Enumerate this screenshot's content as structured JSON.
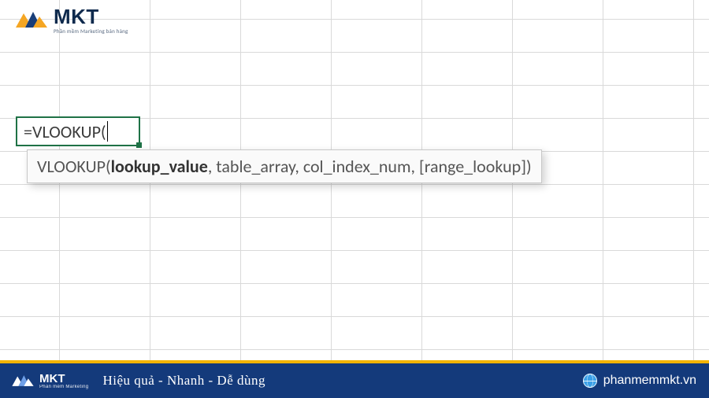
{
  "brand": {
    "name": "MKT",
    "tagline": "Phần mềm Marketing bán hàng"
  },
  "cell": {
    "formula": "=VLOOKUP("
  },
  "tooltip": {
    "fn": "VLOOKUP(",
    "arg_active": "lookup_value",
    "rest": ", table_array, col_index_num, [range_lookup])"
  },
  "footer": {
    "brand_small": "MKT",
    "brand_sub": "Phần mềm Marketing",
    "slogan": "Hiệu quả - Nhanh  - Dễ dùng",
    "site": "phanmemmkt.vn"
  },
  "colors": {
    "accent_green": "#1f7246",
    "footer_blue": "#143a7b",
    "footer_gold": "#f4b400",
    "logo_orange": "#f5a623",
    "logo_blue": "#1a3e78"
  }
}
